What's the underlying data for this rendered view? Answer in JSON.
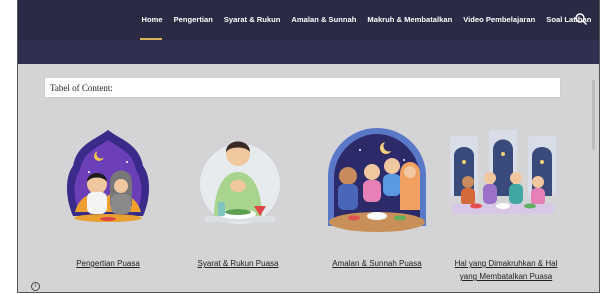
{
  "nav": {
    "items": [
      "Home",
      "Pengertian",
      "Syarat & Rukun",
      "Amalan & Sunnah",
      "Makruh & Membatalkan",
      "Video Pembelajaran",
      "Soal Latihan"
    ],
    "active": "Home",
    "accent": "#d7b35a"
  },
  "toc": {
    "label": "Tabel of Content:"
  },
  "cards": [
    {
      "title": "Pengertian Puasa",
      "illustration": "children-praying-under-crescent"
    },
    {
      "title": "Syarat & Rukun Puasa",
      "illustration": "man-praying-over-food"
    },
    {
      "title": "Amalan & Sunnah Puasa",
      "illustration": "family-iftar-night"
    },
    {
      "title_line1": "Hal yang Dimakruhkan & Hal",
      "title_line2": "yang Membatalkan Puasa",
      "illustration": "group-iftar-mosque-windows"
    }
  ],
  "colors": {
    "navbar": "#2a2a45",
    "page_bg": "#d4d4d7"
  }
}
